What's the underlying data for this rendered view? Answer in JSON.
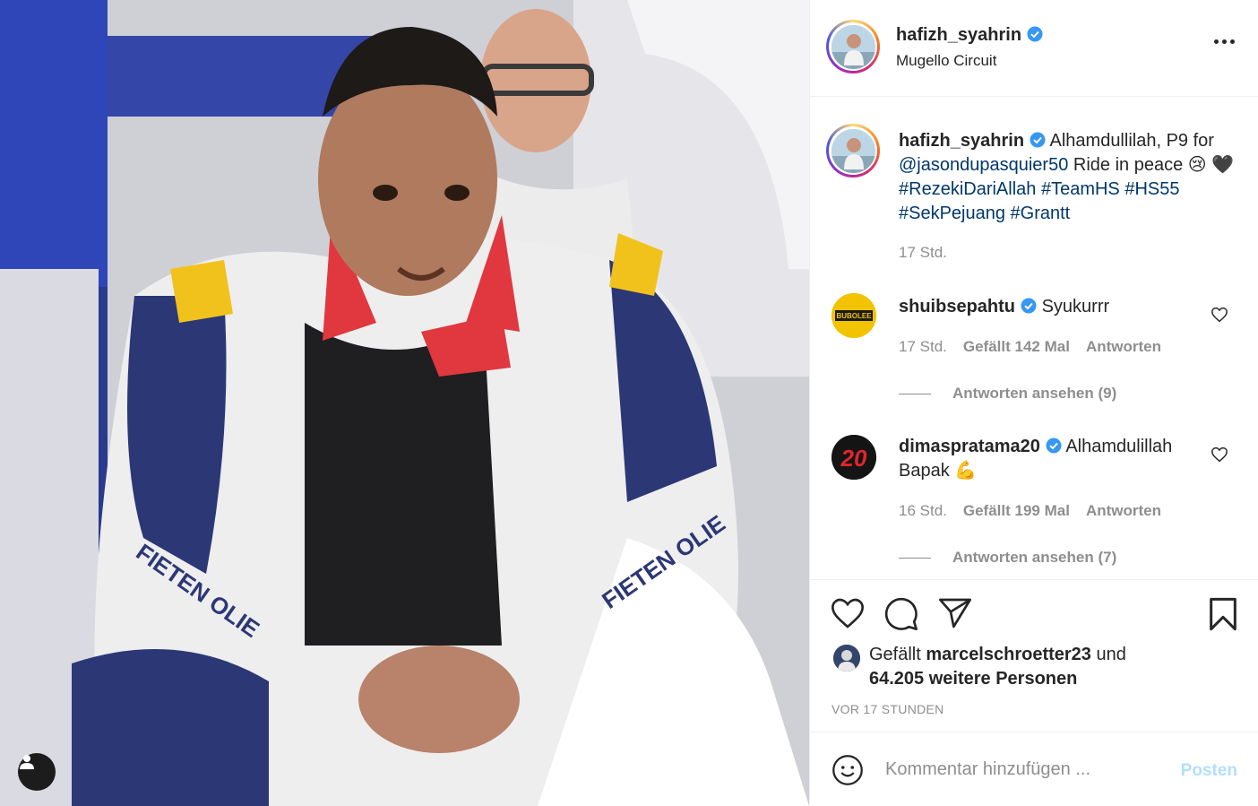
{
  "post": {
    "username": "hafizh_syahrin",
    "location": "Mugello Circuit"
  },
  "caption": {
    "username": "hafizh_syahrin",
    "text_1": "Alhamdullilah, P9 for",
    "mention": "@jasondupasquier50",
    "text_2": "Ride in peace",
    "emoji_1": "😢",
    "emoji_2": "🖤",
    "hashtags": "#RezekiDariAllah #TeamHS #HS55",
    "hashtags_2": "#SekPejuang #Grantt",
    "time": "17 Std."
  },
  "comments": [
    {
      "username": "shuibsepahtu",
      "text": "Syukurrr",
      "time": "17 Std.",
      "likes": "Gefällt 142 Mal",
      "reply": "Antworten",
      "view_replies": "Antworten ansehen (9)",
      "avatar_label": "BUBOLEE"
    },
    {
      "username": "dimaspratama20",
      "text": "Alhamdulillah Bapak",
      "emoji": "💪",
      "time": "16 Std.",
      "likes": "Gefällt 199 Mal",
      "reply": "Antworten",
      "view_replies": "Antworten ansehen (7)",
      "avatar_label": "20"
    }
  ],
  "likes": {
    "prefix": "Gefällt",
    "user": "marcelschroetter23",
    "mid": "und",
    "count": "64.205 weitere Personen"
  },
  "timestamp": "VOR 17 STUNDEN",
  "composer": {
    "placeholder": "Kommentar hinzufügen ...",
    "post_label": "Posten"
  },
  "colors": {
    "verified": "#3897f0",
    "link": "#00376b",
    "muted": "#8e8e8e",
    "post_disabled": "#b2dffc"
  }
}
